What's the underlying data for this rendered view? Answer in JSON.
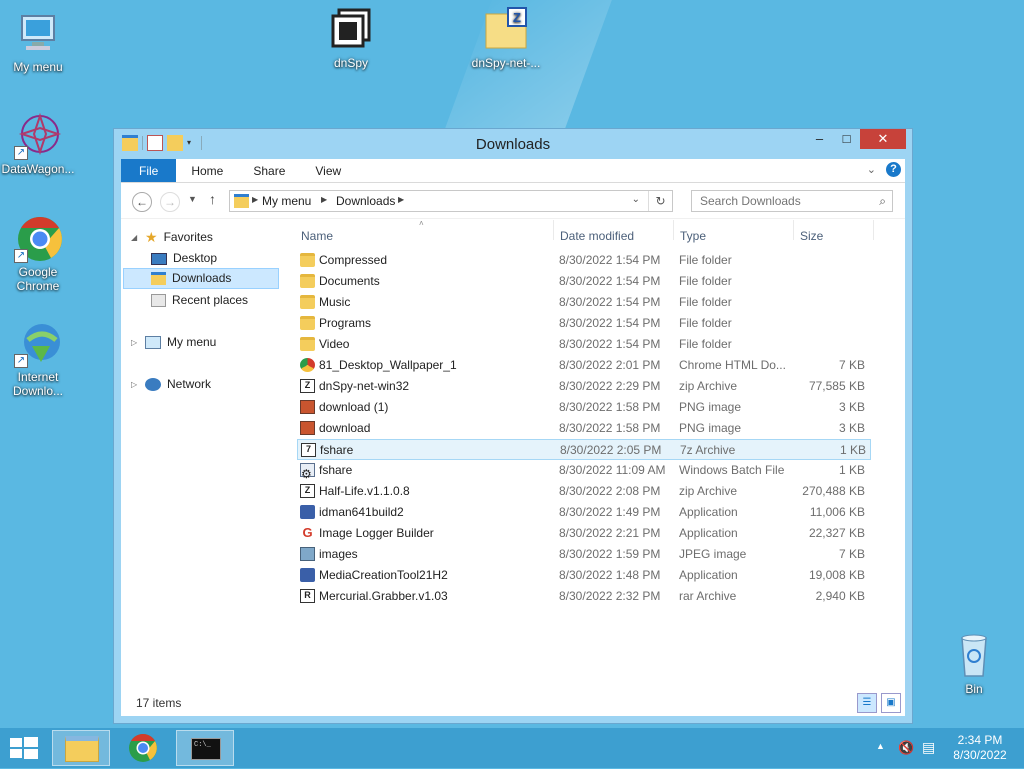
{
  "desktop": {
    "icons": [
      {
        "label": "My menu",
        "icon": "computer-icon"
      },
      {
        "label": "dnSpy",
        "icon": "dnspy-icon"
      },
      {
        "label": "dnSpy-net-...",
        "icon": "zip-folder-icon"
      },
      {
        "label": "DataWagon...",
        "icon": "datawagon-icon"
      },
      {
        "label": "Google Chrome",
        "icon": "chrome-icon"
      },
      {
        "label": "Internet Downlo...",
        "icon": "idm-icon"
      },
      {
        "label": "Bin",
        "icon": "recycle-bin-icon"
      }
    ]
  },
  "window": {
    "title": "Downloads",
    "controls": {
      "minimize": "–",
      "maximize": "□",
      "close": "✕"
    }
  },
  "ribbon": {
    "tabs": [
      "File",
      "Home",
      "Share",
      "View"
    ]
  },
  "address": {
    "crumbs": [
      "My menu",
      "Downloads"
    ],
    "search_placeholder": "Search Downloads"
  },
  "nav": {
    "favorites_label": "Favorites",
    "desktop_label": "Desktop",
    "downloads_label": "Downloads",
    "recent_label": "Recent places",
    "mymenu_label": "My menu",
    "network_label": "Network"
  },
  "columns": {
    "name": "Name",
    "date": "Date modified",
    "type": "Type",
    "size": "Size"
  },
  "files": [
    {
      "name": "Compressed",
      "date": "8/30/2022 1:54 PM",
      "type": "File folder",
      "size": "",
      "icon": "folder-icon"
    },
    {
      "name": "Documents",
      "date": "8/30/2022 1:54 PM",
      "type": "File folder",
      "size": "",
      "icon": "folder-icon"
    },
    {
      "name": "Music",
      "date": "8/30/2022 1:54 PM",
      "type": "File folder",
      "size": "",
      "icon": "folder-icon"
    },
    {
      "name": "Programs",
      "date": "8/30/2022 1:54 PM",
      "type": "File folder",
      "size": "",
      "icon": "folder-icon"
    },
    {
      "name": "Video",
      "date": "8/30/2022 1:54 PM",
      "type": "File folder",
      "size": "",
      "icon": "folder-icon"
    },
    {
      "name": "81_Desktop_Wallpaper_1",
      "date": "8/30/2022 2:01 PM",
      "type": "Chrome HTML Do...",
      "size": "7 KB",
      "icon": "chrome-html-icon"
    },
    {
      "name": "dnSpy-net-win32",
      "date": "8/30/2022 2:29 PM",
      "type": "zip Archive",
      "size": "77,585 KB",
      "icon": "zip-archive-icon"
    },
    {
      "name": "download (1)",
      "date": "8/30/2022 1:58 PM",
      "type": "PNG image",
      "size": "3 KB",
      "icon": "png-image-icon"
    },
    {
      "name": "download",
      "date": "8/30/2022 1:58 PM",
      "type": "PNG image",
      "size": "3 KB",
      "icon": "png-image-icon"
    },
    {
      "name": "fshare",
      "date": "8/30/2022 2:05 PM",
      "type": "7z Archive",
      "size": "1 KB",
      "icon": "7z-archive-icon"
    },
    {
      "name": "fshare",
      "date": "8/30/2022 11:09 AM",
      "type": "Windows Batch File",
      "size": "1 KB",
      "icon": "batch-file-icon"
    },
    {
      "name": "Half-Life.v1.1.0.8",
      "date": "8/30/2022 2:08 PM",
      "type": "zip Archive",
      "size": "270,488 KB",
      "icon": "zip-archive-icon"
    },
    {
      "name": "idman641build2",
      "date": "8/30/2022 1:49 PM",
      "type": "Application",
      "size": "11,006 KB",
      "icon": "idm-app-icon"
    },
    {
      "name": "Image Logger Builder",
      "date": "8/30/2022 2:21 PM",
      "type": "Application",
      "size": "22,327 KB",
      "icon": "g-app-icon"
    },
    {
      "name": "images",
      "date": "8/30/2022 1:59 PM",
      "type": "JPEG image",
      "size": "7 KB",
      "icon": "jpeg-image-icon"
    },
    {
      "name": "MediaCreationTool21H2",
      "date": "8/30/2022 1:48 PM",
      "type": "Application",
      "size": "19,008 KB",
      "icon": "mediacreation-app-icon"
    },
    {
      "name": "Mercurial.Grabber.v1.03",
      "date": "8/30/2022 2:32 PM",
      "type": "rar Archive",
      "size": "2,940 KB",
      "icon": "rar-archive-icon"
    }
  ],
  "selected_row": 9,
  "status": {
    "count": "17 items"
  },
  "taskbar": {
    "time": "2:34 PM",
    "date": "8/30/2022"
  }
}
